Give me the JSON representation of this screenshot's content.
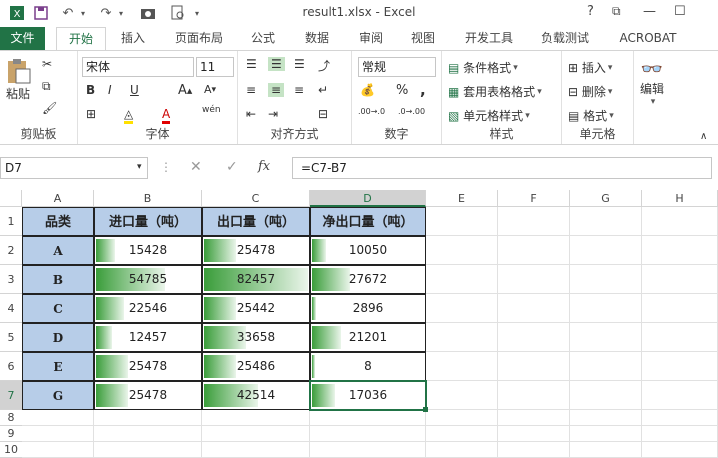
{
  "window": {
    "title": "result1.xlsx - Excel",
    "help": "?",
    "restore": "⧉",
    "minimize": "—",
    "maximize": "☐"
  },
  "tabs": [
    "文件",
    "开始",
    "插入",
    "页面布局",
    "公式",
    "数据",
    "审阅",
    "视图",
    "开发工具",
    "负载测试",
    "ACROBAT"
  ],
  "ribbon": {
    "clipboard": {
      "label": "剪贴板",
      "paste": "粘贴"
    },
    "font": {
      "label": "字体",
      "name": "宋体",
      "size": "11",
      "bold": "B",
      "italic": "I",
      "underline": "U",
      "wen": "wén"
    },
    "alignment": {
      "label": "对齐方式"
    },
    "number": {
      "label": "数字",
      "format": "常规",
      "percent": "%",
      "comma": ",",
      "inc": ".00→.0",
      "dec": ".0→.00"
    },
    "styles": {
      "label": "样式",
      "cond": "条件格式",
      "table": "套用表格格式",
      "cell": "单元格样式"
    },
    "cells": {
      "label": "单元格",
      "insert": "插入",
      "delete": "删除",
      "format": "格式"
    },
    "editing": {
      "label": "编辑"
    }
  },
  "formula": {
    "name": "D7",
    "fx": "fx",
    "content": "=C7-B7"
  },
  "columns": [
    "A",
    "B",
    "C",
    "D",
    "E",
    "F",
    "G",
    "H"
  ],
  "rows": [
    "1",
    "2",
    "3",
    "4",
    "5",
    "6",
    "7",
    "8",
    "9",
    "10"
  ],
  "headers": [
    "品类",
    "进口量（吨）",
    "出口量（吨）",
    "净出口量（吨）"
  ],
  "data": [
    {
      "cat": "A",
      "b": 15428,
      "c": 25478,
      "d": 10050
    },
    {
      "cat": "B",
      "b": 54785,
      "c": 82457,
      "d": 27672
    },
    {
      "cat": "C",
      "b": 22546,
      "c": 25442,
      "d": 2896
    },
    {
      "cat": "D",
      "b": 12457,
      "c": 33658,
      "d": 21201
    },
    {
      "cat": "E",
      "b": 25478,
      "c": 25486,
      "d": 8
    },
    {
      "cat": "G",
      "b": 25478,
      "c": 42514,
      "d": 17036
    }
  ],
  "colors": {
    "accent": "#217346",
    "header_fill": "#b7cde8",
    "bar": "#3a9d3a"
  }
}
